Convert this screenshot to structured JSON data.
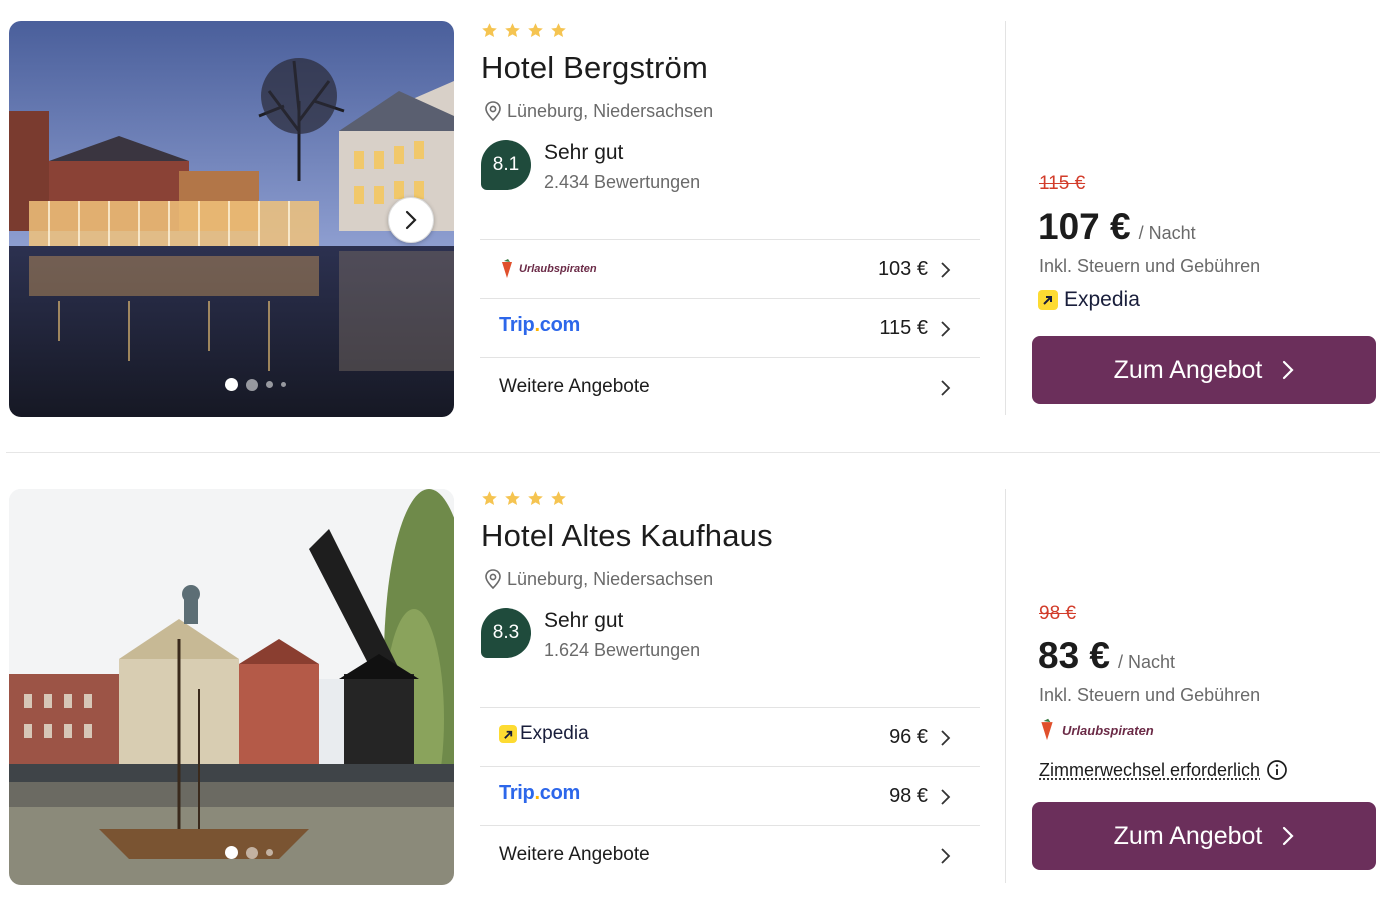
{
  "hotels": [
    {
      "stars": 4,
      "name": "Hotel Bergström",
      "location": "Lüneburg, Niedersachsen",
      "score": "8.1",
      "rating_label": "Sehr gut",
      "reviews": "2.434 Bewertungen",
      "offers": [
        {
          "provider": "Urlaubspiraten",
          "price": "103 €"
        },
        {
          "provider": "Trip.com",
          "price": "115 €"
        }
      ],
      "more_offers": "Weitere Angebote",
      "old_price": "115 €",
      "price": "107 €",
      "per_night": "/ Nacht",
      "taxes": "Inkl. Steuern und Gebühren",
      "deal_provider": "Expedia",
      "cta": "Zum Angebot",
      "photo_index": 1,
      "photo_count": 4
    },
    {
      "stars": 4,
      "name": "Hotel Altes Kaufhaus",
      "location": "Lüneburg, Niedersachsen",
      "score": "8.3",
      "rating_label": "Sehr gut",
      "reviews": "1.624 Bewertungen",
      "offers": [
        {
          "provider": "Expedia",
          "price": "96 €"
        },
        {
          "provider": "Trip.com",
          "price": "98 €"
        }
      ],
      "more_offers": "Weitere Angebote",
      "old_price": "98 €",
      "price": "83 €",
      "per_night": "/ Nacht",
      "taxes": "Inkl. Steuern und Gebühren",
      "deal_provider": "Urlaubspiraten",
      "notice": "Zimmerwechsel erforderlich",
      "cta": "Zum Angebot",
      "photo_index": 1,
      "photo_count": 3
    }
  ],
  "logos": {
    "trip_main": "Trip",
    "trip_dot": ".",
    "trip_tld": "com",
    "urlaub": "Urlaubspiraten",
    "expedia": "Expedia"
  },
  "colors": {
    "score_bg": "#1f4b3c",
    "cta_bg": "#6b2f5b",
    "old_price": "#d23c2a",
    "star": "#f5c451",
    "trip_blue": "#2d67ea",
    "expedia_yellow": "#fddb32"
  }
}
